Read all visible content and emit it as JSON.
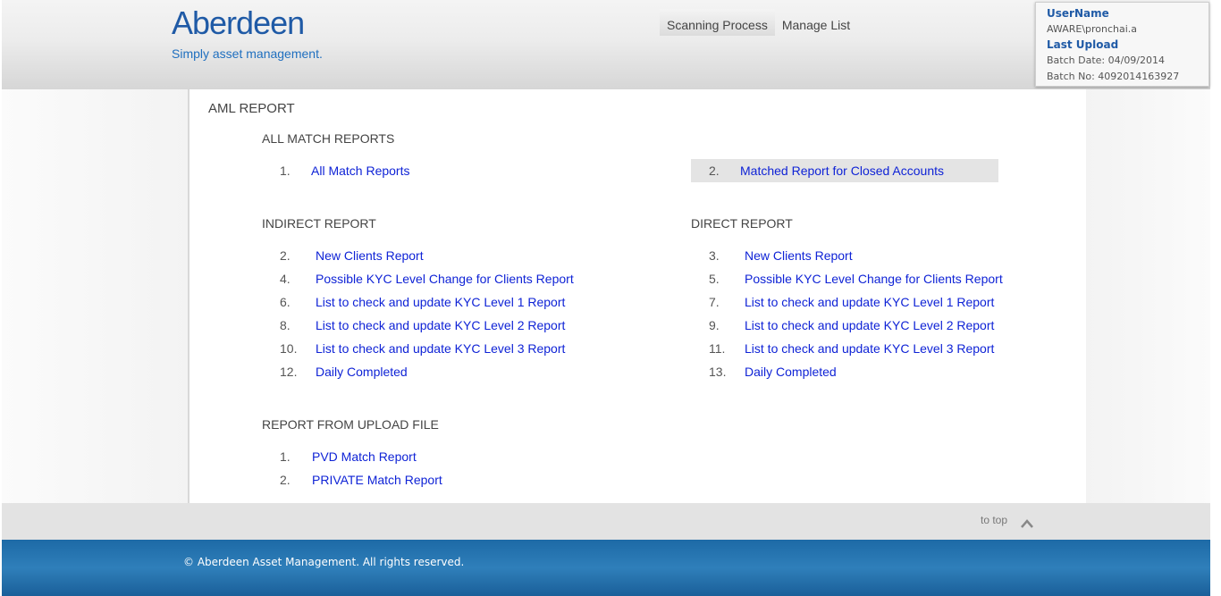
{
  "header": {
    "logo_word": "Aberdeen",
    "logo_tagline": "Simply asset management.",
    "nav": [
      "Scanning Process",
      "Manage List"
    ],
    "user": {
      "username_label": "UserName",
      "username": "AWARE\\pronchai.a",
      "last_upload_label": "Last Upload",
      "batch_date": "Batch Date: 04/09/2014",
      "batch_no": "Batch No: 4092014163927"
    }
  },
  "main": {
    "title": "AML REPORT",
    "all_match": {
      "title": "ALL MATCH REPORTS",
      "items": [
        {
          "num": "1.",
          "label": "All Match Reports"
        },
        {
          "num": "2.",
          "label": "Matched Report for Closed Accounts"
        }
      ]
    },
    "indirect": {
      "title": "INDIRECT REPORT",
      "items": [
        {
          "num": "2.",
          "label": "New Clients Report"
        },
        {
          "num": "4.",
          "label": "Possible KYC Level Change for Clients Report"
        },
        {
          "num": "6.",
          "label": "List to check and update KYC Level 1 Report"
        },
        {
          "num": "8.",
          "label": "List to check and update KYC Level 2 Report"
        },
        {
          "num": "10.",
          "label": "List to check and update KYC Level 3 Report"
        },
        {
          "num": "12.",
          "label": "Daily Completed"
        }
      ]
    },
    "direct": {
      "title": "DIRECT REPORT",
      "items": [
        {
          "num": "3.",
          "label": "New Clients Report"
        },
        {
          "num": "5.",
          "label": "Possible KYC Level Change for Clients Report"
        },
        {
          "num": "7.",
          "label": "List to check and update KYC Level 1 Report"
        },
        {
          "num": "9.",
          "label": "List to check and update KYC Level 2 Report"
        },
        {
          "num": "11.",
          "label": "List to check and update KYC Level 3 Report"
        },
        {
          "num": "13.",
          "label": "Daily Completed"
        }
      ]
    },
    "upload": {
      "title": "REPORT FROM UPLOAD FILE",
      "items": [
        {
          "num": "1.",
          "label": "PVD Match Report"
        },
        {
          "num": "2.",
          "label": "PRIVATE Match Report"
        }
      ]
    }
  },
  "footer": {
    "to_top": "to top",
    "copyright": "© Aberdeen Asset Management. All rights reserved."
  },
  "colors": {
    "link": "#0f23d6",
    "brand": "#1f5aa6",
    "footer_bar": "#2f7fba"
  }
}
